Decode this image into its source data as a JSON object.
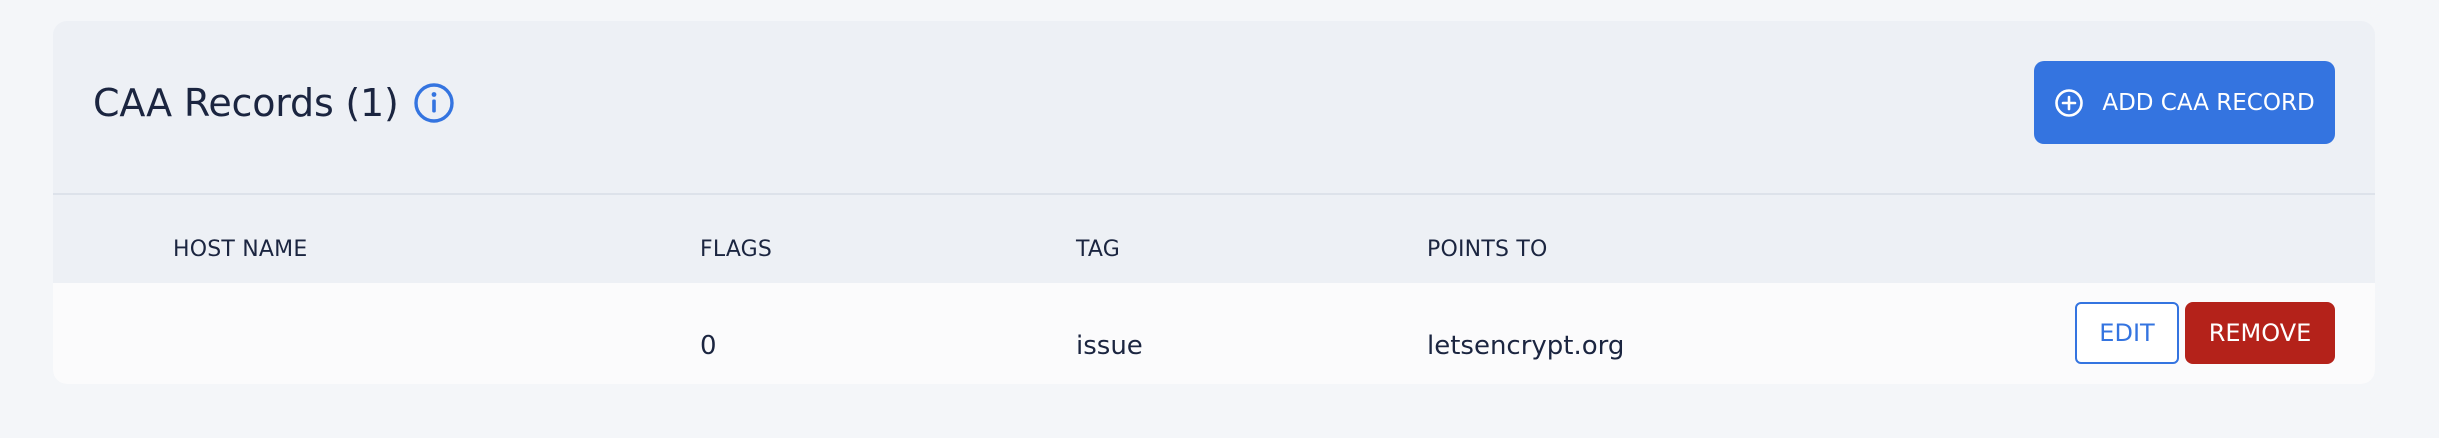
{
  "header": {
    "title": "CAA Records (1)",
    "add_button_label": "ADD CAA RECORD"
  },
  "table": {
    "columns": [
      "HOST NAME",
      "FLAGS",
      "TAG",
      "POINTS TO"
    ],
    "rows": [
      {
        "host_name": "",
        "flags": "0",
        "tag": "issue",
        "points_to": "letsencrypt.org",
        "edit_label": "EDIT",
        "remove_label": "REMOVE"
      }
    ]
  },
  "colors": {
    "accent": "#3474e0",
    "danger": "#b4221a",
    "card_bg": "#edf0f5",
    "row_bg": "#fbfbfc",
    "text": "#1b2540"
  },
  "icons": {
    "title_icon": "info-icon",
    "add_icon": "plus-circle-icon"
  }
}
